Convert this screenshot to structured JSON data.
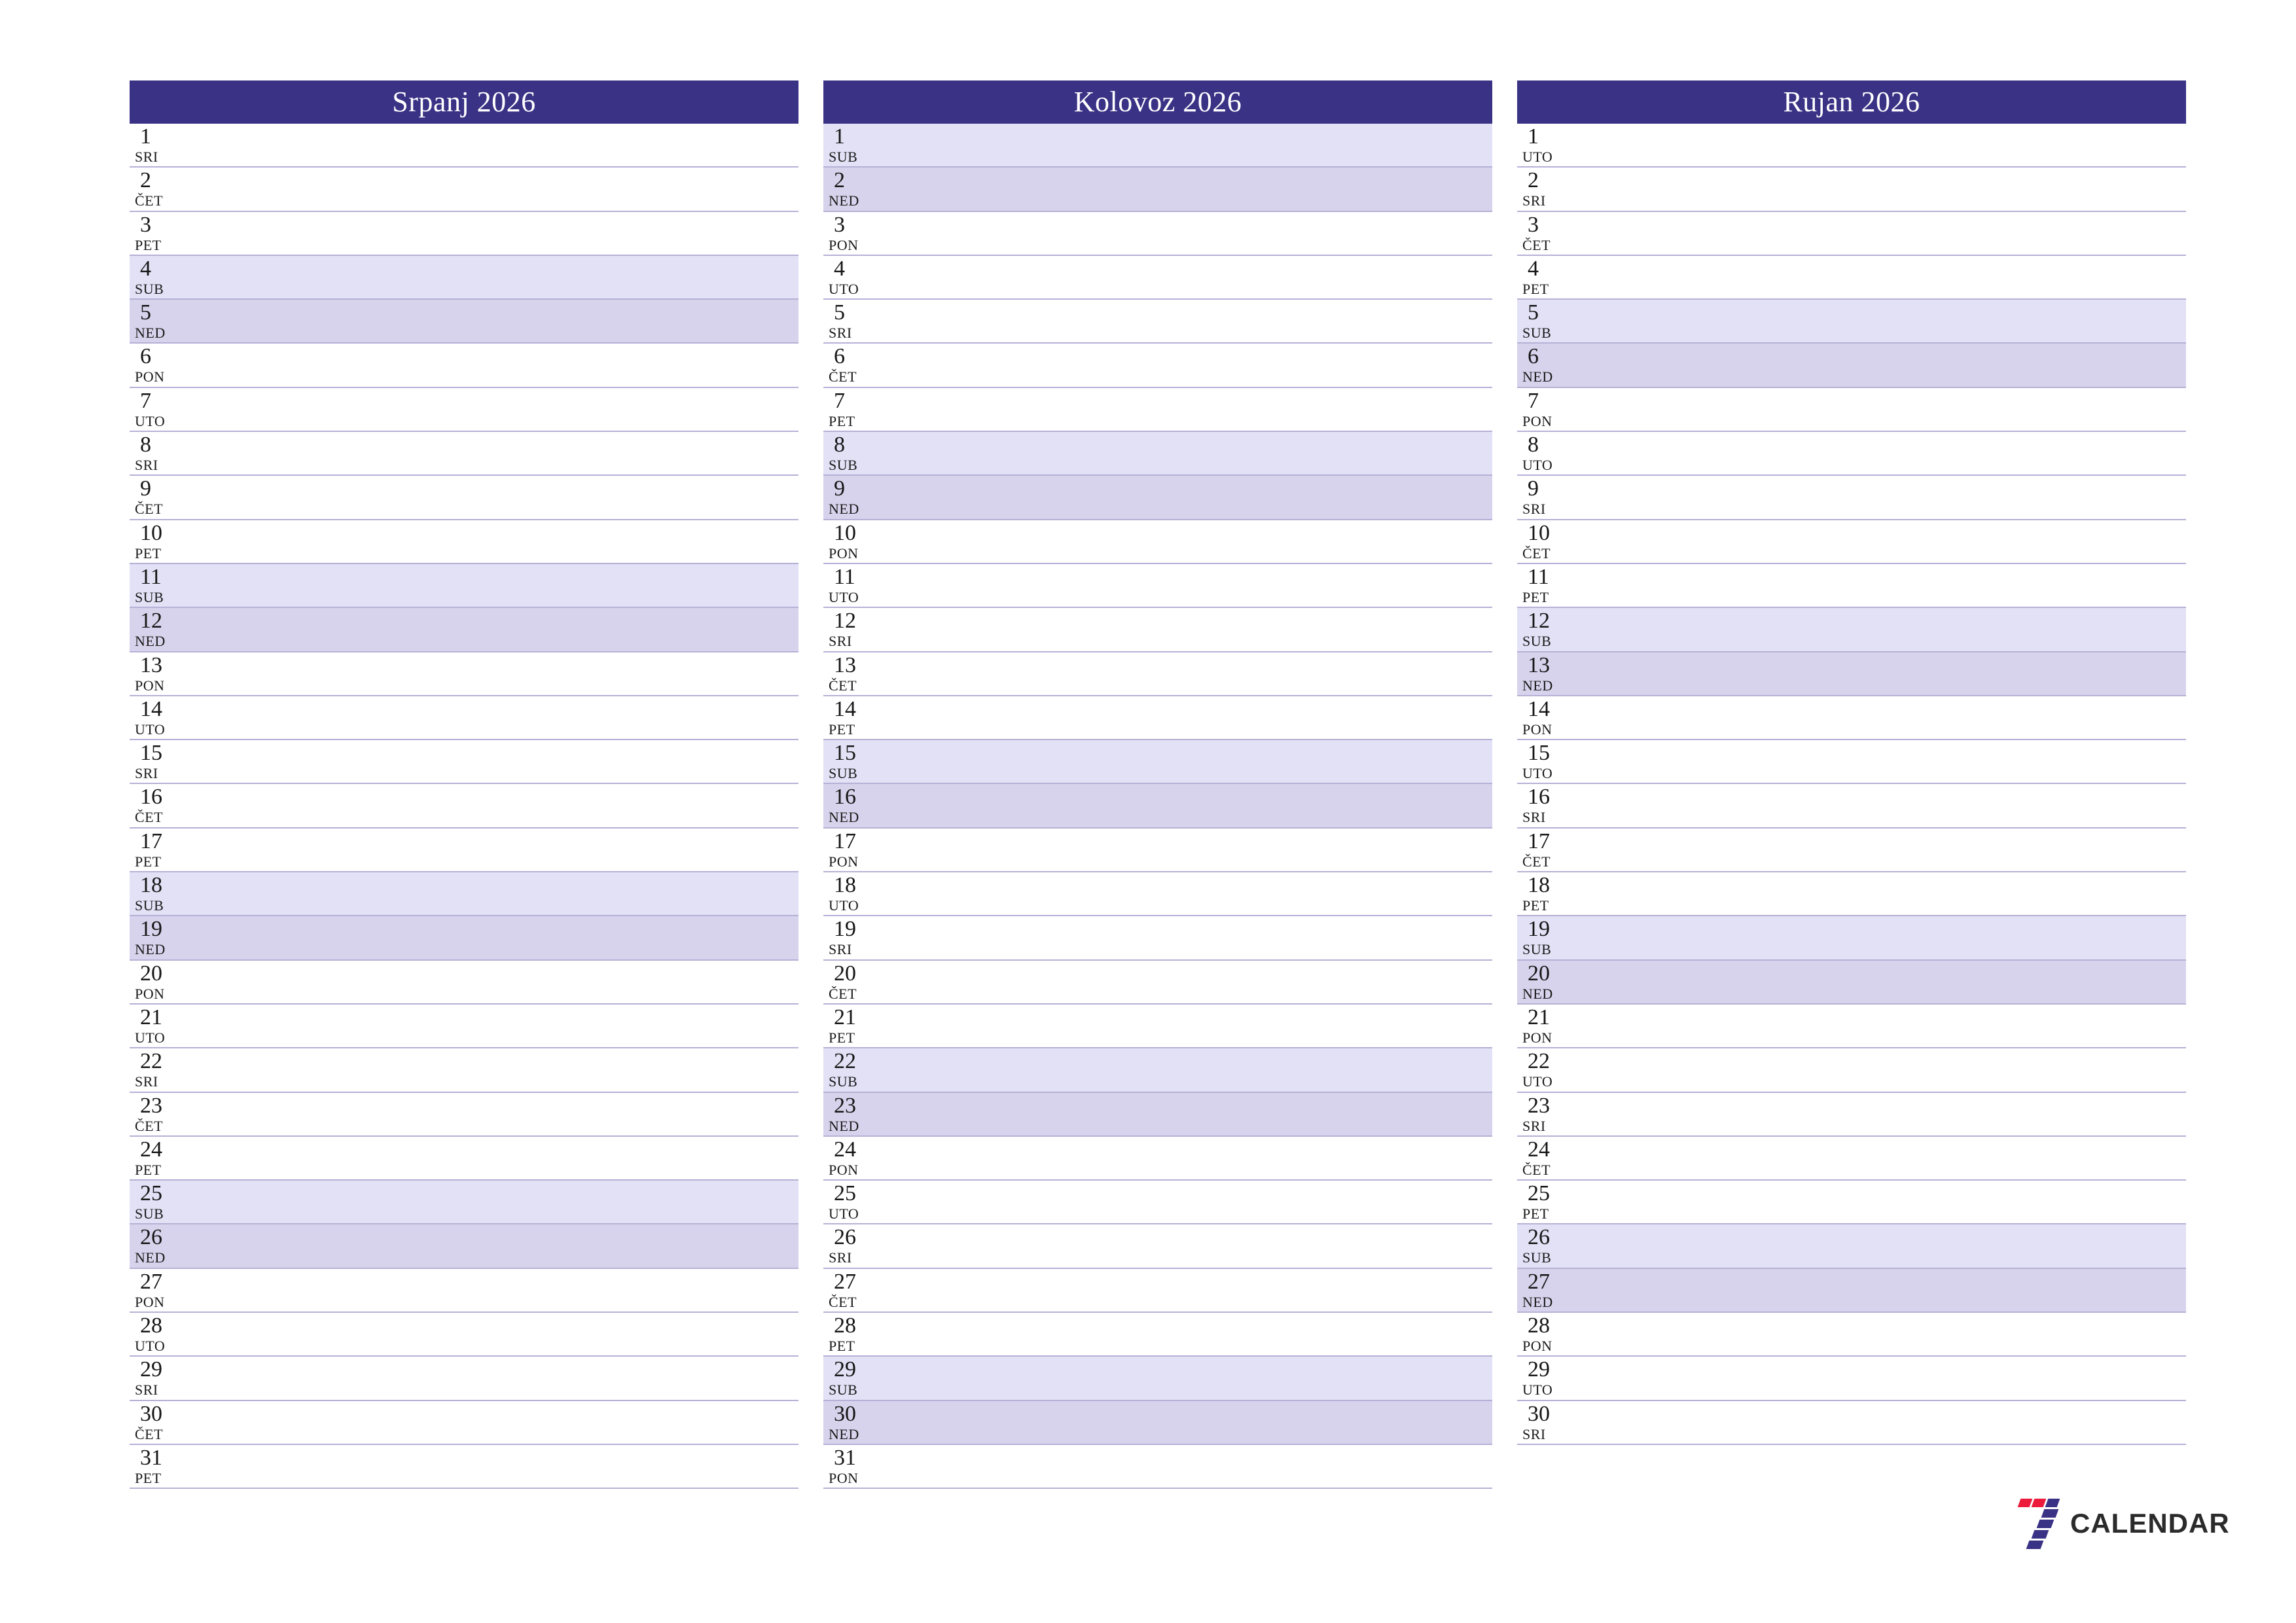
{
  "calendar": {
    "year": "2026",
    "colors": {
      "header_bg": "#3A3285",
      "header_text": "#FFFFFF",
      "saturday_bg": "#E2E1F6",
      "sunday_bg": "#D8D3EC",
      "row_border": "#B5B1D6",
      "logo_red": "#EC1B3B",
      "logo_navy": "#3A3285",
      "logo_text": "#2B2B2B"
    },
    "months": [
      {
        "title": "Srpanj 2026",
        "name": "Srpanj",
        "days": [
          {
            "num": "1",
            "name": "SRI",
            "type": "weekday"
          },
          {
            "num": "2",
            "name": "ČET",
            "type": "weekday"
          },
          {
            "num": "3",
            "name": "PET",
            "type": "weekday"
          },
          {
            "num": "4",
            "name": "SUB",
            "type": "sat"
          },
          {
            "num": "5",
            "name": "NED",
            "type": "sun"
          },
          {
            "num": "6",
            "name": "PON",
            "type": "weekday"
          },
          {
            "num": "7",
            "name": "UTO",
            "type": "weekday"
          },
          {
            "num": "8",
            "name": "SRI",
            "type": "weekday"
          },
          {
            "num": "9",
            "name": "ČET",
            "type": "weekday"
          },
          {
            "num": "10",
            "name": "PET",
            "type": "weekday"
          },
          {
            "num": "11",
            "name": "SUB",
            "type": "sat"
          },
          {
            "num": "12",
            "name": "NED",
            "type": "sun"
          },
          {
            "num": "13",
            "name": "PON",
            "type": "weekday"
          },
          {
            "num": "14",
            "name": "UTO",
            "type": "weekday"
          },
          {
            "num": "15",
            "name": "SRI",
            "type": "weekday"
          },
          {
            "num": "16",
            "name": "ČET",
            "type": "weekday"
          },
          {
            "num": "17",
            "name": "PET",
            "type": "weekday"
          },
          {
            "num": "18",
            "name": "SUB",
            "type": "sat"
          },
          {
            "num": "19",
            "name": "NED",
            "type": "sun"
          },
          {
            "num": "20",
            "name": "PON",
            "type": "weekday"
          },
          {
            "num": "21",
            "name": "UTO",
            "type": "weekday"
          },
          {
            "num": "22",
            "name": "SRI",
            "type": "weekday"
          },
          {
            "num": "23",
            "name": "ČET",
            "type": "weekday"
          },
          {
            "num": "24",
            "name": "PET",
            "type": "weekday"
          },
          {
            "num": "25",
            "name": "SUB",
            "type": "sat"
          },
          {
            "num": "26",
            "name": "NED",
            "type": "sun"
          },
          {
            "num": "27",
            "name": "PON",
            "type": "weekday"
          },
          {
            "num": "28",
            "name": "UTO",
            "type": "weekday"
          },
          {
            "num": "29",
            "name": "SRI",
            "type": "weekday"
          },
          {
            "num": "30",
            "name": "ČET",
            "type": "weekday"
          },
          {
            "num": "31",
            "name": "PET",
            "type": "weekday"
          }
        ]
      },
      {
        "title": "Kolovoz 2026",
        "name": "Kolovoz",
        "days": [
          {
            "num": "1",
            "name": "SUB",
            "type": "sat"
          },
          {
            "num": "2",
            "name": "NED",
            "type": "sun"
          },
          {
            "num": "3",
            "name": "PON",
            "type": "weekday"
          },
          {
            "num": "4",
            "name": "UTO",
            "type": "weekday"
          },
          {
            "num": "5",
            "name": "SRI",
            "type": "weekday"
          },
          {
            "num": "6",
            "name": "ČET",
            "type": "weekday"
          },
          {
            "num": "7",
            "name": "PET",
            "type": "weekday"
          },
          {
            "num": "8",
            "name": "SUB",
            "type": "sat"
          },
          {
            "num": "9",
            "name": "NED",
            "type": "sun"
          },
          {
            "num": "10",
            "name": "PON",
            "type": "weekday"
          },
          {
            "num": "11",
            "name": "UTO",
            "type": "weekday"
          },
          {
            "num": "12",
            "name": "SRI",
            "type": "weekday"
          },
          {
            "num": "13",
            "name": "ČET",
            "type": "weekday"
          },
          {
            "num": "14",
            "name": "PET",
            "type": "weekday"
          },
          {
            "num": "15",
            "name": "SUB",
            "type": "sat"
          },
          {
            "num": "16",
            "name": "NED",
            "type": "sun"
          },
          {
            "num": "17",
            "name": "PON",
            "type": "weekday"
          },
          {
            "num": "18",
            "name": "UTO",
            "type": "weekday"
          },
          {
            "num": "19",
            "name": "SRI",
            "type": "weekday"
          },
          {
            "num": "20",
            "name": "ČET",
            "type": "weekday"
          },
          {
            "num": "21",
            "name": "PET",
            "type": "weekday"
          },
          {
            "num": "22",
            "name": "SUB",
            "type": "sat"
          },
          {
            "num": "23",
            "name": "NED",
            "type": "sun"
          },
          {
            "num": "24",
            "name": "PON",
            "type": "weekday"
          },
          {
            "num": "25",
            "name": "UTO",
            "type": "weekday"
          },
          {
            "num": "26",
            "name": "SRI",
            "type": "weekday"
          },
          {
            "num": "27",
            "name": "ČET",
            "type": "weekday"
          },
          {
            "num": "28",
            "name": "PET",
            "type": "weekday"
          },
          {
            "num": "29",
            "name": "SUB",
            "type": "sat"
          },
          {
            "num": "30",
            "name": "NED",
            "type": "sun"
          },
          {
            "num": "31",
            "name": "PON",
            "type": "weekday"
          }
        ]
      },
      {
        "title": "Rujan 2026",
        "name": "Rujan",
        "days": [
          {
            "num": "1",
            "name": "UTO",
            "type": "weekday"
          },
          {
            "num": "2",
            "name": "SRI",
            "type": "weekday"
          },
          {
            "num": "3",
            "name": "ČET",
            "type": "weekday"
          },
          {
            "num": "4",
            "name": "PET",
            "type": "weekday"
          },
          {
            "num": "5",
            "name": "SUB",
            "type": "sat"
          },
          {
            "num": "6",
            "name": "NED",
            "type": "sun"
          },
          {
            "num": "7",
            "name": "PON",
            "type": "weekday"
          },
          {
            "num": "8",
            "name": "UTO",
            "type": "weekday"
          },
          {
            "num": "9",
            "name": "SRI",
            "type": "weekday"
          },
          {
            "num": "10",
            "name": "ČET",
            "type": "weekday"
          },
          {
            "num": "11",
            "name": "PET",
            "type": "weekday"
          },
          {
            "num": "12",
            "name": "SUB",
            "type": "sat"
          },
          {
            "num": "13",
            "name": "NED",
            "type": "sun"
          },
          {
            "num": "14",
            "name": "PON",
            "type": "weekday"
          },
          {
            "num": "15",
            "name": "UTO",
            "type": "weekday"
          },
          {
            "num": "16",
            "name": "SRI",
            "type": "weekday"
          },
          {
            "num": "17",
            "name": "ČET",
            "type": "weekday"
          },
          {
            "num": "18",
            "name": "PET",
            "type": "weekday"
          },
          {
            "num": "19",
            "name": "SUB",
            "type": "sat"
          },
          {
            "num": "20",
            "name": "NED",
            "type": "sun"
          },
          {
            "num": "21",
            "name": "PON",
            "type": "weekday"
          },
          {
            "num": "22",
            "name": "UTO",
            "type": "weekday"
          },
          {
            "num": "23",
            "name": "SRI",
            "type": "weekday"
          },
          {
            "num": "24",
            "name": "ČET",
            "type": "weekday"
          },
          {
            "num": "25",
            "name": "PET",
            "type": "weekday"
          },
          {
            "num": "26",
            "name": "SUB",
            "type": "sat"
          },
          {
            "num": "27",
            "name": "NED",
            "type": "sun"
          },
          {
            "num": "28",
            "name": "PON",
            "type": "weekday"
          },
          {
            "num": "29",
            "name": "UTO",
            "type": "weekday"
          },
          {
            "num": "30",
            "name": "SRI",
            "type": "weekday"
          }
        ]
      }
    ]
  },
  "logo": {
    "mark": "seven-logo-icon",
    "text": "CALENDAR"
  }
}
